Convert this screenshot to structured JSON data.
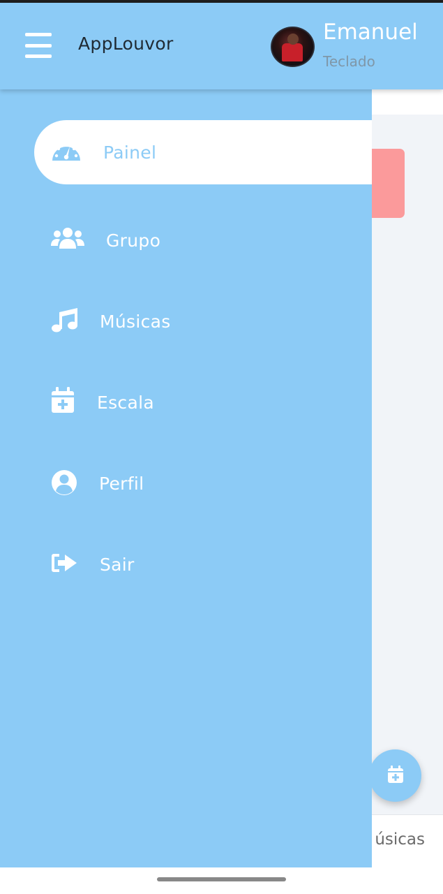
{
  "header": {
    "app_title": "AppLouvor",
    "user": {
      "name": "Emanuel",
      "role": "Teclado"
    }
  },
  "drawer": {
    "items": [
      {
        "label": "Painel",
        "icon": "dashboard-gauge-icon",
        "active": true
      },
      {
        "label": "Grupo",
        "icon": "users-group-icon",
        "active": false
      },
      {
        "label": "Músicas",
        "icon": "music-note-icon",
        "active": false
      },
      {
        "label": "Escala",
        "icon": "calendar-plus-icon",
        "active": false
      },
      {
        "label": "Perfil",
        "icon": "user-circle-icon",
        "active": false
      },
      {
        "label": "Sair",
        "icon": "sign-out-icon",
        "active": false
      }
    ]
  },
  "background": {
    "bottom_tab_partial_label": "úsicas",
    "fab_icon": "calendar-plus-icon"
  },
  "colors": {
    "primary": "#8ccbf6",
    "alert": "#fb9a9b",
    "white": "#ffffff",
    "title_text": "#1f2a33",
    "role_text": "#7f97a8"
  }
}
